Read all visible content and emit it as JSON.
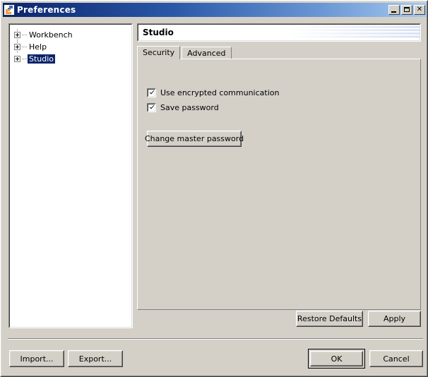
{
  "window": {
    "title": "Preferences",
    "icon": "eclipse-icon",
    "controls": {
      "minimize": "_",
      "maximize": "□",
      "close": "✕"
    }
  },
  "tree": {
    "items": [
      {
        "label": "Workbench",
        "expandable": true,
        "selected": false
      },
      {
        "label": "Help",
        "expandable": true,
        "selected": false
      },
      {
        "label": "Studio",
        "expandable": true,
        "selected": true
      }
    ]
  },
  "page": {
    "title": "Studio",
    "tabs": [
      {
        "label": "Security",
        "active": true
      },
      {
        "label": "Advanced",
        "active": false
      }
    ],
    "checkboxes": [
      {
        "label": "Use encrypted communication",
        "checked": true
      },
      {
        "label": "Save password",
        "checked": true
      }
    ],
    "change_password_button": "Change master password",
    "restore_defaults_button": "Restore Defaults",
    "apply_button": "Apply"
  },
  "footer": {
    "import_button": "Import...",
    "export_button": "Export...",
    "ok_button": "OK",
    "cancel_button": "Cancel"
  },
  "colors": {
    "dialog_face": "#d4d0c8",
    "title_gradient_start": "#0a246a",
    "title_gradient_end": "#a6caf0",
    "selection": "#0a246a",
    "stripe": "#b6c7e8"
  }
}
